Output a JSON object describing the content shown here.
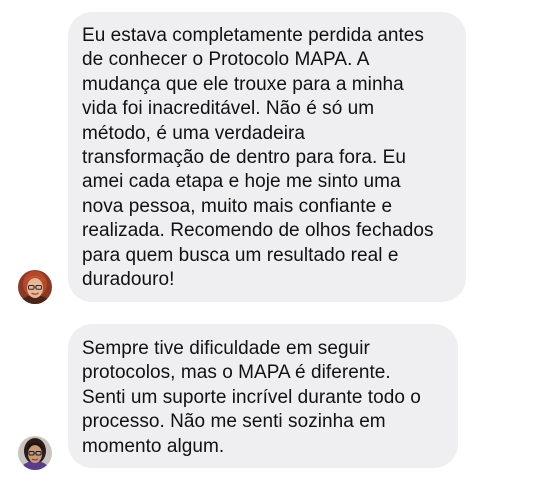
{
  "messages": [
    {
      "avatar": "woman-red-hair-glasses-avatar",
      "lines": [
        "Eu estava completamente perdida antes",
        "de conhecer o Protocolo MAPA. A",
        "mudança que ele trouxe para a minha",
        "vida foi inacreditável. Não é só um",
        "método, é uma verdadeira",
        "transformação de dentro para fora. Eu",
        "amei cada etapa e hoje me sinto uma",
        "nova pessoa, muito mais confiante e",
        "realizada. Recomendo de olhos fechados",
        "para quem busca um resultado real e",
        "duradouro!"
      ]
    },
    {
      "avatar": "woman-dark-hair-glasses-avatar",
      "lines": [
        "Sempre tive dificuldade em seguir",
        "protocolos, mas o MAPA é diferente.",
        "Senti um suporte incrível durante todo o",
        "processo. Não me senti sozinha em",
        "momento algum."
      ]
    }
  ],
  "colors": {
    "bubble_bg": "#efeff1",
    "text": "#111111",
    "page_bg": "#ffffff"
  }
}
